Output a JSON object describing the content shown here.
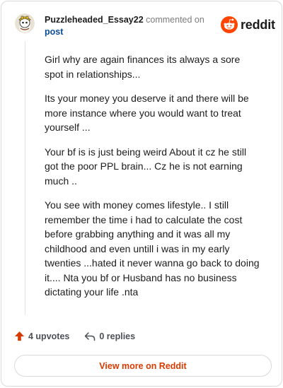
{
  "comment": {
    "author": "Puzzleheaded_Essay22",
    "action_text": "commented on",
    "post_link": "post",
    "paragraphs": [
      "Girl why are again finances its always a sore spot in relationships...",
      "Its your money you deserve it and there will be more instance where you would want to treat yourself ...",
      "Your bf is is just being weird About it cz he still got the poor PPL brain... Cz he is not earning much ..",
      "You see with money comes lifestyle.. I still remember the time i had to calculate the cost before grabbing anything and it was all my childhood and even untill i was in my early twenties ...hated it never wanna go back to doing it.... Nta you bf or Husband has no business dictating your life .nta"
    ],
    "upvotes_label": "4 upvotes",
    "replies_label": "0 replies"
  },
  "brand": {
    "wordmark": "reddit"
  },
  "footer": {
    "view_more_label": "View more on Reddit"
  },
  "colors": {
    "brand_orange": "#ff4500",
    "link_blue": "#0a4b9a",
    "view_more_text": "#d93a00",
    "upvote_arrow": "#d93a00"
  },
  "icons": {
    "avatar": "snoo-avatar-yellow-hat",
    "logo": "reddit-snoo-logo",
    "upvote": "upvote-arrow-icon",
    "reply": "reply-arrow-icon"
  }
}
